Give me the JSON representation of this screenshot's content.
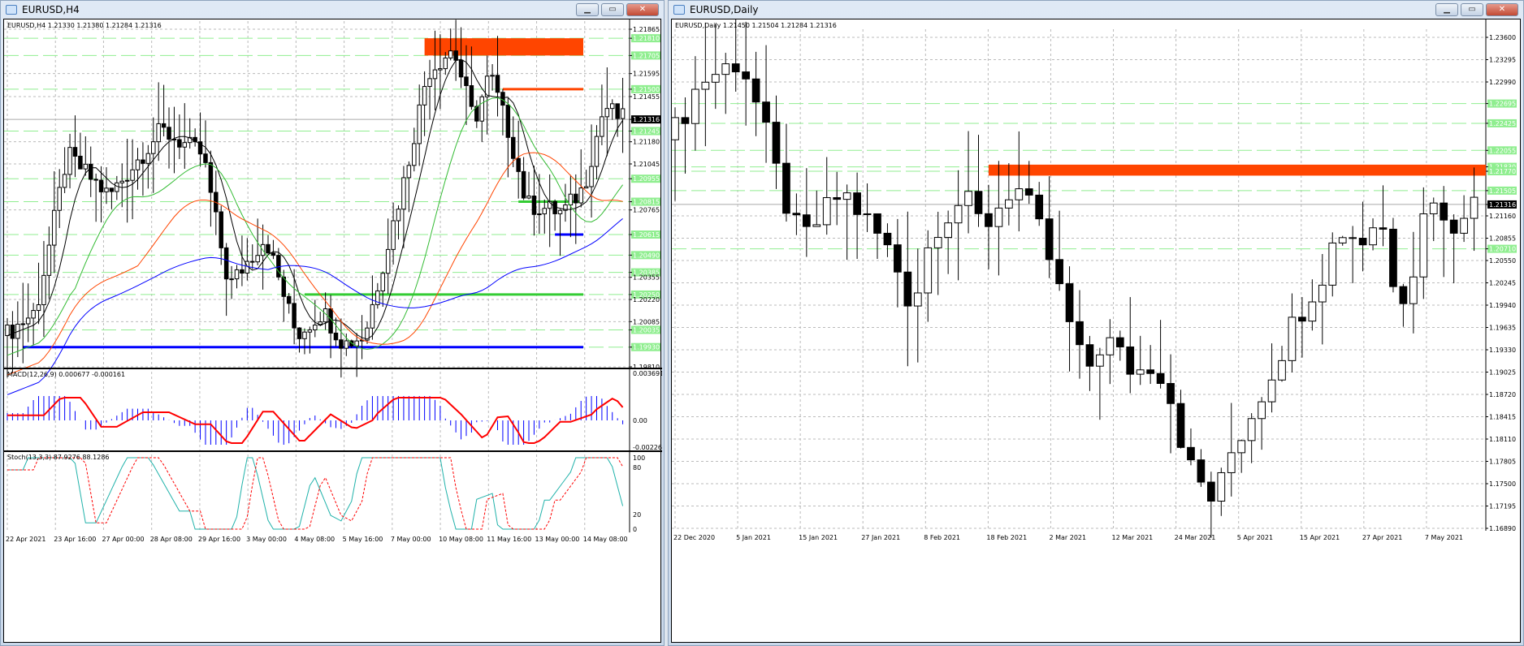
{
  "left": {
    "title": "EURUSD,H4",
    "header": "EURUSD,H4  1.21330 1.21380 1.21284 1.21316",
    "price_range": [
      1.1981,
      1.21865
    ],
    "price_labels": [
      {
        "v": "1.21865"
      },
      {
        "v": "1.21810",
        "hl": "green"
      },
      {
        "v": "1.21705",
        "hl": "green"
      },
      {
        "v": "1.21595"
      },
      {
        "v": "1.21500",
        "hl": "green"
      },
      {
        "v": "1.21455"
      },
      {
        "v": "1.21316",
        "hl": "black"
      },
      {
        "v": "1.21245",
        "hl": "green"
      },
      {
        "v": "1.21180"
      },
      {
        "v": "1.21045"
      },
      {
        "v": "1.20955",
        "hl": "green"
      },
      {
        "v": "1.20815",
        "hl": "green"
      },
      {
        "v": "1.20765"
      },
      {
        "v": "1.20615",
        "hl": "green"
      },
      {
        "v": "1.20490",
        "hl": "green"
      },
      {
        "v": "1.20385",
        "hl": "green"
      },
      {
        "v": "1.20355"
      },
      {
        "v": "1.20250",
        "hl": "green"
      },
      {
        "v": "1.20220"
      },
      {
        "v": "1.20085"
      },
      {
        "v": "1.20035",
        "hl": "green"
      },
      {
        "v": "1.19930",
        "hl": "green"
      },
      {
        "v": "1.19810"
      }
    ],
    "path": [
      [
        0,
        1.2
      ],
      [
        6,
        1.2015
      ],
      [
        12,
        1.211
      ],
      [
        20,
        1.2085
      ],
      [
        30,
        1.2125
      ],
      [
        38,
        1.211
      ],
      [
        43,
        1.203
      ],
      [
        50,
        1.206
      ],
      [
        56,
        1.2
      ],
      [
        61,
        1.2015
      ],
      [
        65,
        1.1995
      ],
      [
        69,
        1.2
      ],
      [
        77,
        1.21
      ],
      [
        81,
        1.216
      ],
      [
        86,
        1.2175
      ],
      [
        90,
        1.213
      ],
      [
        93,
        1.216
      ],
      [
        97,
        1.212
      ],
      [
        100,
        1.208
      ],
      [
        107,
        1.2075
      ],
      [
        111,
        1.209
      ],
      [
        115,
        1.214
      ],
      [
        118,
        1.2132
      ]
    ],
    "candles": 119,
    "zone": {
      "from": 1.21705,
      "to": 1.2181,
      "color": "#ff4500"
    },
    "levels": [
      {
        "price": 1.215,
        "color": "#ff4500",
        "start": 95
      },
      {
        "price": 1.20815,
        "color": "#33cc33",
        "start": 98
      },
      {
        "price": 1.20615,
        "color": "#0000ff",
        "start": 105
      },
      {
        "price": 1.2025,
        "color": "#33cc33",
        "start": 57
      },
      {
        "price": 1.1993,
        "color": "#0000ff",
        "start": 3
      }
    ],
    "macd": {
      "label": "MACD(12,26,9) 0.000677 -0.000161",
      "ticks": [
        "0.003691",
        "0.00",
        "-0.002261"
      ]
    },
    "stoch": {
      "label": "Stoch(13,3,3) 87.9276 88.1286",
      "ticks": [
        "100",
        "80",
        "20",
        "0"
      ]
    },
    "time_labels": [
      "22 Apr 2021",
      "23 Apr 16:00",
      "27 Apr 00:00",
      "28 Apr 08:00",
      "29 Apr 16:00",
      "3 May 00:00",
      "4 May 08:00",
      "5 May 16:00",
      "7 May 00:00",
      "10 May 08:00",
      "11 May 16:00",
      "13 May 00:00",
      "14 May 08:00"
    ]
  },
  "right": {
    "title": "EURUSD,Daily",
    "header": "EURUSD,Daily  1.21450 1.21504 1.21284 1.21316",
    "price_range": [
      1.1689,
      1.236
    ],
    "price_labels": [
      {
        "v": "1.23600"
      },
      {
        "v": "1.23295"
      },
      {
        "v": "1.22990"
      },
      {
        "v": "1.22695",
        "hl": "green"
      },
      {
        "v": "1.22425",
        "hl": "green"
      },
      {
        "v": "1.22055",
        "hl": "green"
      },
      {
        "v": "1.21830",
        "hl": "green"
      },
      {
        "v": "1.21770",
        "hl": "green"
      },
      {
        "v": "1.21505",
        "hl": "green"
      },
      {
        "v": "1.21316",
        "hl": "black"
      },
      {
        "v": "1.21160"
      },
      {
        "v": "1.20855"
      },
      {
        "v": "1.20710",
        "hl": "green"
      },
      {
        "v": "1.20550"
      },
      {
        "v": "1.20245"
      },
      {
        "v": "1.19940"
      },
      {
        "v": "1.19635"
      },
      {
        "v": "1.19330"
      },
      {
        "v": "1.19025"
      },
      {
        "v": "1.18720"
      },
      {
        "v": "1.18415"
      },
      {
        "v": "1.18110"
      },
      {
        "v": "1.17805"
      },
      {
        "v": "1.17500"
      },
      {
        "v": "1.17195"
      },
      {
        "v": "1.16890"
      }
    ],
    "path": [
      [
        0,
        1.222
      ],
      [
        3,
        1.23
      ],
      [
        7,
        1.233
      ],
      [
        9,
        1.225
      ],
      [
        11,
        1.215
      ],
      [
        13,
        1.208
      ],
      [
        17,
        1.215
      ],
      [
        20,
        1.21
      ],
      [
        22,
        1.206
      ],
      [
        24,
        1.199
      ],
      [
        26,
        1.21
      ],
      [
        29,
        1.214
      ],
      [
        31,
        1.21
      ],
      [
        34,
        1.216
      ],
      [
        35,
        1.214
      ],
      [
        37,
        1.208
      ],
      [
        39,
        1.199
      ],
      [
        41,
        1.19
      ],
      [
        43,
        1.195
      ],
      [
        46,
        1.19
      ],
      [
        48,
        1.192
      ],
      [
        50,
        1.185
      ],
      [
        51,
        1.178
      ],
      [
        54,
        1.172
      ],
      [
        55,
        1.178
      ],
      [
        58,
        1.186
      ],
      [
        60,
        1.192
      ],
      [
        62,
        1.198
      ],
      [
        65,
        1.205
      ],
      [
        66,
        1.21
      ],
      [
        69,
        1.208
      ],
      [
        70,
        1.213
      ],
      [
        72,
        1.2
      ],
      [
        74,
        1.206
      ],
      [
        75,
        1.217
      ],
      [
        77,
        1.208
      ],
      [
        78,
        1.213
      ],
      [
        79,
        1.2132
      ]
    ],
    "candles": 80,
    "zone": {
      "from": 1.2171,
      "to": 1.2186,
      "color": "#ff4500"
    },
    "time_labels": [
      "22 Dec 2020",
      "5 Jan 2021",
      "15 Jan 2021",
      "27 Jan 2021",
      "8 Feb 2021",
      "18 Feb 2021",
      "2 Mar 2021",
      "12 Mar 2021",
      "24 Mar 2021",
      "5 Apr 2021",
      "15 Apr 2021",
      "27 Apr 2021",
      "7 May 2021"
    ]
  },
  "buttons": {
    "min": "▁",
    "max": "▭",
    "close": "✕"
  }
}
